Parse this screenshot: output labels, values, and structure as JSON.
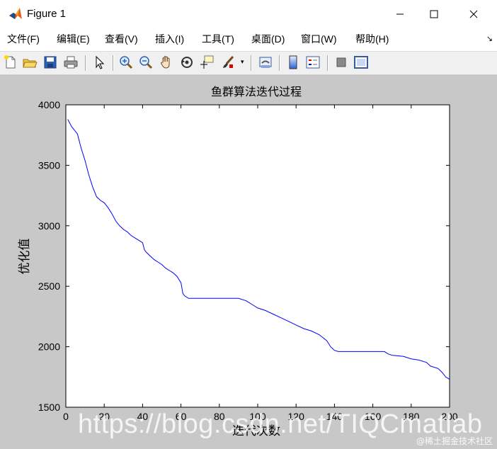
{
  "window": {
    "title": "Figure 1"
  },
  "menu": {
    "items": [
      "文件(F)",
      "编辑(E)",
      "查看(V)",
      "插入(I)",
      "工具(T)",
      "桌面(D)",
      "窗口(W)",
      "帮助(H)"
    ]
  },
  "toolbar": {
    "icons": [
      "new-figure-icon",
      "open-file-icon",
      "save-icon",
      "print-icon",
      "pointer-icon",
      "zoom-in-icon",
      "zoom-out-icon",
      "pan-hand-icon",
      "rotate-3d-icon",
      "data-cursor-icon",
      "brush-icon",
      "link-plot-icon",
      "colorbar-icon",
      "legend-icon",
      "hide-plot-tools-icon",
      "show-plot-tools-icon"
    ]
  },
  "colors": {
    "figure_bg": "#c8c8c8",
    "axes_bg": "#ffffff",
    "line": "#0000ff"
  },
  "chart_data": {
    "type": "line",
    "title": "鱼群算法迭代过程",
    "xlabel": "迭代次数",
    "ylabel": "优化值",
    "xlim": [
      0,
      200
    ],
    "ylim": [
      1500,
      4000
    ],
    "xticks": [
      0,
      20,
      40,
      60,
      80,
      100,
      120,
      140,
      160,
      180,
      200
    ],
    "yticks": [
      1500,
      2000,
      2500,
      3000,
      3500,
      4000
    ],
    "grid": false,
    "series": [
      {
        "color": "#0000ff",
        "x": [
          1,
          3,
          6,
          8,
          10,
          12,
          14,
          16,
          18,
          20,
          22,
          24,
          26,
          28,
          30,
          32,
          34,
          36,
          38,
          40,
          41,
          42,
          44,
          46,
          48,
          50,
          52,
          54,
          56,
          58,
          60,
          61,
          62,
          64,
          70,
          80,
          90,
          94,
          98,
          100,
          104,
          108,
          112,
          116,
          120,
          124,
          128,
          132,
          136,
          138,
          140,
          142,
          150,
          160,
          166,
          168,
          170,
          176,
          180,
          184,
          188,
          190,
          194,
          196,
          198,
          200
        ],
        "y": [
          3880,
          3820,
          3760,
          3640,
          3540,
          3420,
          3320,
          3240,
          3210,
          3190,
          3150,
          3100,
          3040,
          3000,
          2970,
          2950,
          2920,
          2900,
          2880,
          2860,
          2800,
          2780,
          2750,
          2720,
          2700,
          2680,
          2650,
          2630,
          2610,
          2580,
          2530,
          2440,
          2420,
          2400,
          2400,
          2400,
          2400,
          2380,
          2340,
          2320,
          2300,
          2270,
          2240,
          2210,
          2180,
          2150,
          2130,
          2100,
          2050,
          2000,
          1970,
          1960,
          1960,
          1960,
          1960,
          1940,
          1930,
          1920,
          1900,
          1890,
          1870,
          1840,
          1820,
          1790,
          1750,
          1730
        ]
      }
    ]
  },
  "watermark": {
    "url": "https://blog.csdn.net/TIQCmatlab",
    "credit": "@稀土掘金技术社区"
  }
}
